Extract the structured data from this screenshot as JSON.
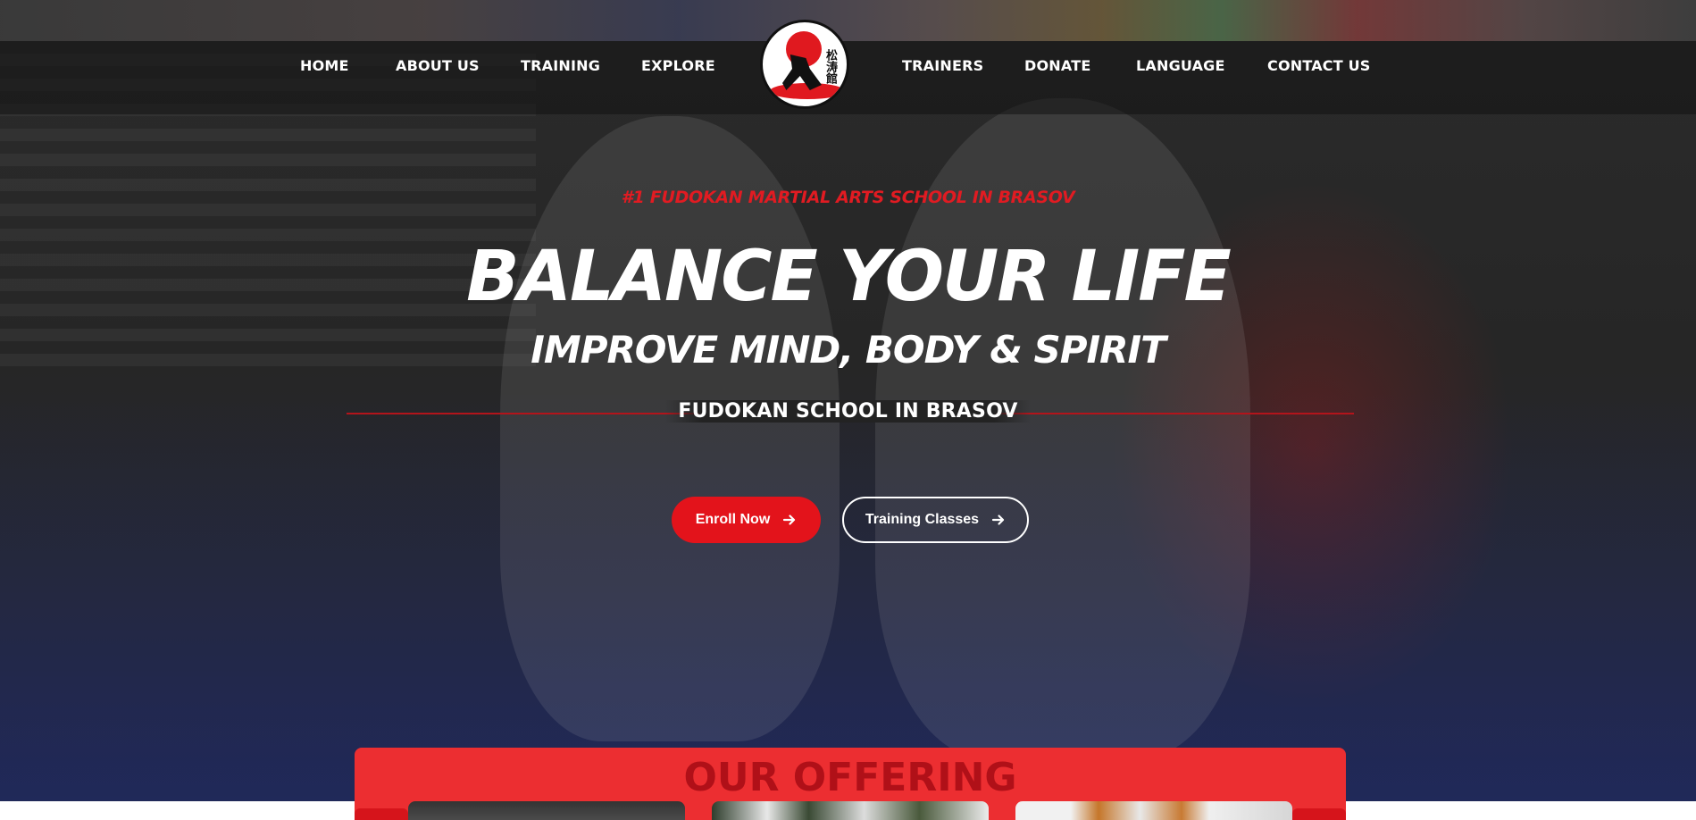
{
  "nav": {
    "items": [
      {
        "label": "HOME"
      },
      {
        "label": "ABOUT US"
      },
      {
        "label": "TRAINING"
      },
      {
        "label": "EXPLORE"
      },
      {
        "label": "TRAINERS"
      },
      {
        "label": "DONATE"
      },
      {
        "label": "LANGUAGE"
      },
      {
        "label": "CONTACT US"
      }
    ],
    "logo_icon": "fudokan-logo"
  },
  "hero": {
    "kicker": "#1 FUDOKAN MARTIAL ARTS SCHOOL IN BRASOV",
    "headline": "BALANCE YOUR LIFE",
    "subheadline": "IMPROVE MIND, BODY & SPIRIT",
    "tagline": "FUDOKAN SCHOOL IN BRASOV",
    "buttons": {
      "enroll": {
        "label": "Enroll Now",
        "icon": "arrow-right-icon"
      },
      "classes": {
        "label": "Training Classes",
        "icon": "arrow-right-icon"
      }
    }
  },
  "offering": {
    "title": "OUR OFFERING"
  },
  "colors": {
    "accent": "#e3131b",
    "offering_bg": "#ec2e31",
    "offering_title": "#b01018"
  }
}
